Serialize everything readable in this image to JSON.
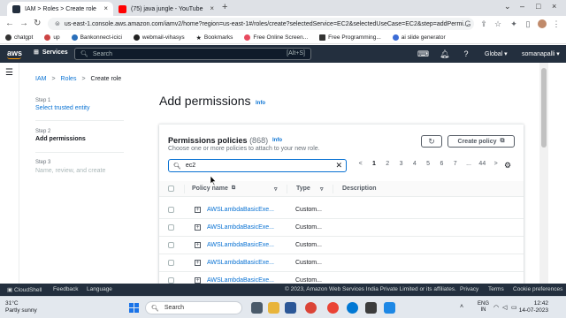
{
  "browser": {
    "tabs": [
      {
        "title": "IAM > Roles > Create role",
        "close": "×"
      },
      {
        "title": "(75) java jungle - YouTube",
        "close": "×"
      }
    ],
    "new_tab": "+",
    "window_controls": [
      "⌄",
      "–",
      "□",
      "×"
    ],
    "url": "us-east-1.console.aws.amazon.com/iamv2/home?region=us-east-1#/roles/create?selectedService=EC2&selectedUseCase=EC2&step=addPermi..."
  },
  "bookmarks": [
    {
      "label": "chatgpt",
      "color": "#333333"
    },
    {
      "label": "up",
      "color": "#c44"
    },
    {
      "label": "Bankonnect-icici",
      "color": "#2a6fba"
    },
    {
      "label": "webmail-vihasys",
      "color": "#222222"
    },
    {
      "label": "Bookmarks",
      "color": "#222222"
    },
    {
      "label": "Free Online Screen...",
      "color": "#e84a5f"
    },
    {
      "label": "Free Programming...",
      "color": "#333333"
    },
    {
      "label": "ai slide generator",
      "color": "#3b6cd6"
    }
  ],
  "aws_header": {
    "logo": "aws",
    "services": "Services",
    "search_placeholder": "Search",
    "search_shortcut": "[Alt+S]",
    "region": "Global",
    "user": "somanapalli"
  },
  "breadcrumb": {
    "iam": "IAM",
    "roles": "Roles",
    "current": "Create role",
    "sep": ">"
  },
  "steps": [
    {
      "label": "Step 1",
      "title": "Select trusted entity"
    },
    {
      "label": "Step 2",
      "title": "Add permissions"
    },
    {
      "label": "Step 3",
      "title": "Name, review, and create"
    }
  ],
  "page": {
    "title": "Add permissions",
    "info": "Info"
  },
  "policies": {
    "title": "Permissions policies",
    "count": "(868)",
    "info": "Info",
    "description": "Choose one or more policies to attach to your new role.",
    "create_button": "Create policy",
    "filter_value": "ec2",
    "pagination": [
      "<",
      "1",
      "2",
      "3",
      "4",
      "5",
      "6",
      "7",
      "...",
      "44",
      ">"
    ],
    "current_page": "1",
    "columns": {
      "name": "Policy name",
      "type": "Type",
      "description": "Description"
    },
    "rows": [
      {
        "name": "AWSLambdaBasicExe...",
        "type": "Custom...",
        "description": ""
      },
      {
        "name": "AWSLambdaBasicExe...",
        "type": "Custom...",
        "description": ""
      },
      {
        "name": "AWSLambdaBasicExe...",
        "type": "Custom...",
        "description": ""
      },
      {
        "name": "AWSLambdaBasicExe...",
        "type": "Custom...",
        "description": ""
      },
      {
        "name": "AWSLambdaBasicExe...",
        "type": "Custom...",
        "description": ""
      }
    ]
  },
  "footer": {
    "cloudshell": "CloudShell",
    "feedback": "Feedback",
    "language": "Language",
    "copyright": "© 2023, Amazon Web Services India Private Limited or its affiliates.",
    "privacy": "Privacy",
    "terms": "Terms",
    "cookies": "Cookie preferences"
  },
  "taskbar": {
    "temp": "31°C",
    "weather": "Partly sunny",
    "search": "Search",
    "lang1": "ENG",
    "lang2": "IN",
    "time": "12:42",
    "date": "14-07-2023"
  },
  "colors": {
    "aws_navy": "#232f3e",
    "aws_orange": "#ff9900",
    "link_blue": "#0972d3"
  }
}
